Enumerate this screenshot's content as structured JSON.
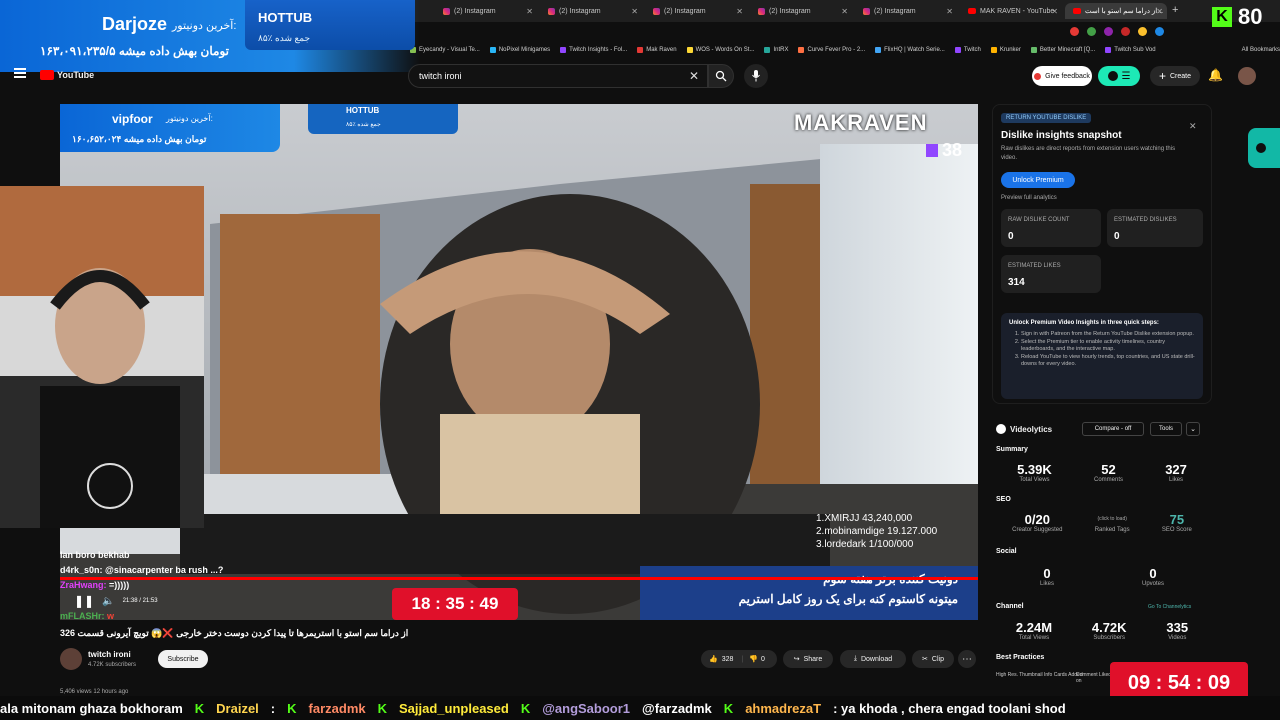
{
  "browser": {
    "tabs": [
      {
        "label": "(2) Instagram",
        "kind": "ig"
      },
      {
        "label": "(2) Instagram",
        "kind": "ig"
      },
      {
        "label": "(2) Instagram",
        "kind": "ig"
      },
      {
        "label": "(2) Instagram",
        "kind": "ig"
      },
      {
        "label": "(2) Instagram",
        "kind": "ig"
      },
      {
        "label": "MAK RAVEN - YouTube",
        "kind": "yt"
      },
      {
        "label": "از دراما سم استو با است...",
        "kind": "yt"
      }
    ],
    "bookmarks": [
      "Eyecandy - Visual Te...",
      "NoPixel Minigames",
      "Twitch Insights - Fol...",
      "Mak Raven",
      "WOS - Words On St...",
      "IntRX",
      "Curve Fever Pro - 2...",
      "FlixHQ | Watch Serie...",
      "Twitch",
      "Krunker",
      "Better Minecraft [Q...",
      "Twitch Sub Vod"
    ],
    "all_bookmarks": "All Bookmarks"
  },
  "overlay": {
    "last_donor_label": "آخرین دونیتور:",
    "last_donor_name": "Darjoze",
    "donation_amount_text": "۱۶۳،۰۹۱،۲۳۵/۵ تومان بهش داده میشه",
    "hottub_title": "HOTTUB",
    "hottub_sub": "۸۵٪ جمع شده",
    "kick_count": "80",
    "clock": "09 : 54 : 09"
  },
  "youtube": {
    "logo": "YouTube",
    "search_value": "twitch ironi",
    "give_feedback": "Give feedback",
    "create": "Create"
  },
  "video": {
    "inner_donor_label": "آخرین دونیتور:",
    "inner_donor_name": "vipfoor",
    "inner_donation_text": "۱۶۰،۶۵۲،۰۲۴ تومان بهش داده میشه",
    "inner_hottub_title": "HOTTUB",
    "inner_hottub_sub": "۸۵٪ جمع شده",
    "channel_watermark": "MAKRAVEN",
    "twitch_count": "38",
    "leaderboard": [
      "1.XMIRJJ 43,240,000",
      "2.mobinamdige 19.127.000",
      "3.lordedark 1/100/000"
    ],
    "timer": "18 : 35 : 49",
    "banner_line1": "دونیت کننده برتر هفته سوم",
    "banner_line2": "میتونه کاستوم کنه برای یک روز کامل استریم",
    "chat_lines": [
      {
        "user": "lan boro bekhab",
        "msg": ""
      },
      {
        "user": "d4rk_s0n:",
        "msg": "@sinacarpenter ba rush ...?"
      },
      {
        "user": "ZraHwang:",
        "msg": "=)))))"
      },
      {
        "user": "mFLASHr:",
        "msg": "w"
      }
    ],
    "time_display": "21:38 / 21:53"
  },
  "video_meta": {
    "title": "از دراما سم استو با استریمرها تا پیدا کردن دوست دختر خارجی ❌😱 تویچ آیرونی قسمت 326",
    "channel": "twitch ironi",
    "subscribers": "4.72K subscribers",
    "subscribe": "Subscribe",
    "likes": "328",
    "dislikes": "0",
    "share": "Share",
    "download": "Download",
    "clip": "Clip",
    "views_line": "5,406 views  12 hours ago"
  },
  "return_dislike": {
    "header": "RETURN YOUTUBE DISLIKE",
    "title": "Dislike insights snapshot",
    "desc": "Raw dislikes are direct reports from extension users watching this video.",
    "unlock_btn": "Unlock Premium",
    "preview": "Preview full analytics",
    "raw_label": "RAW DISLIKE COUNT",
    "raw_value": "0",
    "est_dislike_label": "ESTIMATED DISLIKES",
    "est_dislike_value": "0",
    "est_like_label": "ESTIMATED LIKES",
    "est_like_value": "314",
    "steps_title": "Unlock Premium Video Insights in three quick steps:",
    "steps": [
      "Sign in with Patreon from the Return YouTube Dislike extension popup.",
      "Select the Premium tier to enable activity timelines, country leaderboards, and the interactive map.",
      "Reload YouTube to view hourly trends, top countries, and US state drill-downs for every video."
    ]
  },
  "videolytics": {
    "name": "Videolytics",
    "compare": "Compare - off",
    "tools": "Tools",
    "summary": "Summary",
    "total_views": "5.39K",
    "total_views_lbl": "Total Views",
    "comments": "52",
    "comments_lbl": "Comments",
    "likes": "327",
    "likes_lbl": "Likes",
    "seo": "SEO",
    "creator_suggested": "0/20",
    "creator_suggested_lbl": "Creator Suggested",
    "ranked_tags": "(click to load)",
    "ranked_tags_lbl": "Ranked Tags",
    "seo_score": "75",
    "seo_score_lbl": "SEO Score",
    "social": "Social",
    "social_likes": "0",
    "social_likes_lbl": "Likes",
    "upvotes": "0",
    "upvotes_lbl": "Upvotes",
    "channel": "Channel",
    "go_channel": "Go To Channelytics",
    "ch_views": "2.24M",
    "ch_views_lbl": "Total Views",
    "ch_subs": "4.72K",
    "ch_subs_lbl": "Subscribers",
    "ch_videos": "335",
    "ch_videos_lbl": "Videos",
    "best_practices": "Best Practices",
    "bp1": "High Res. Thumbnail Info Cards Added",
    "bp2": "Comment Liked on"
  },
  "ticker": [
    {
      "user": "",
      "msg": "ala mitonam ghaza bokhoram"
    },
    {
      "user": "Draizel",
      "msg": ":"
    },
    {
      "user": "farzadmk",
      "msg": ""
    },
    {
      "user": "Sajjad_unpleased",
      "msg": ""
    },
    {
      "user": "@angSaboor1",
      "msg": "@farzadmk"
    },
    {
      "user": "ahmadrezaT",
      "msg": ": ya khoda , chera engad toolani shod"
    }
  ],
  "colors": {
    "accent_blue": "#1e88e5",
    "red": "#ff0000",
    "kick_green": "#53fc18",
    "clock_red": "#e0102a"
  }
}
